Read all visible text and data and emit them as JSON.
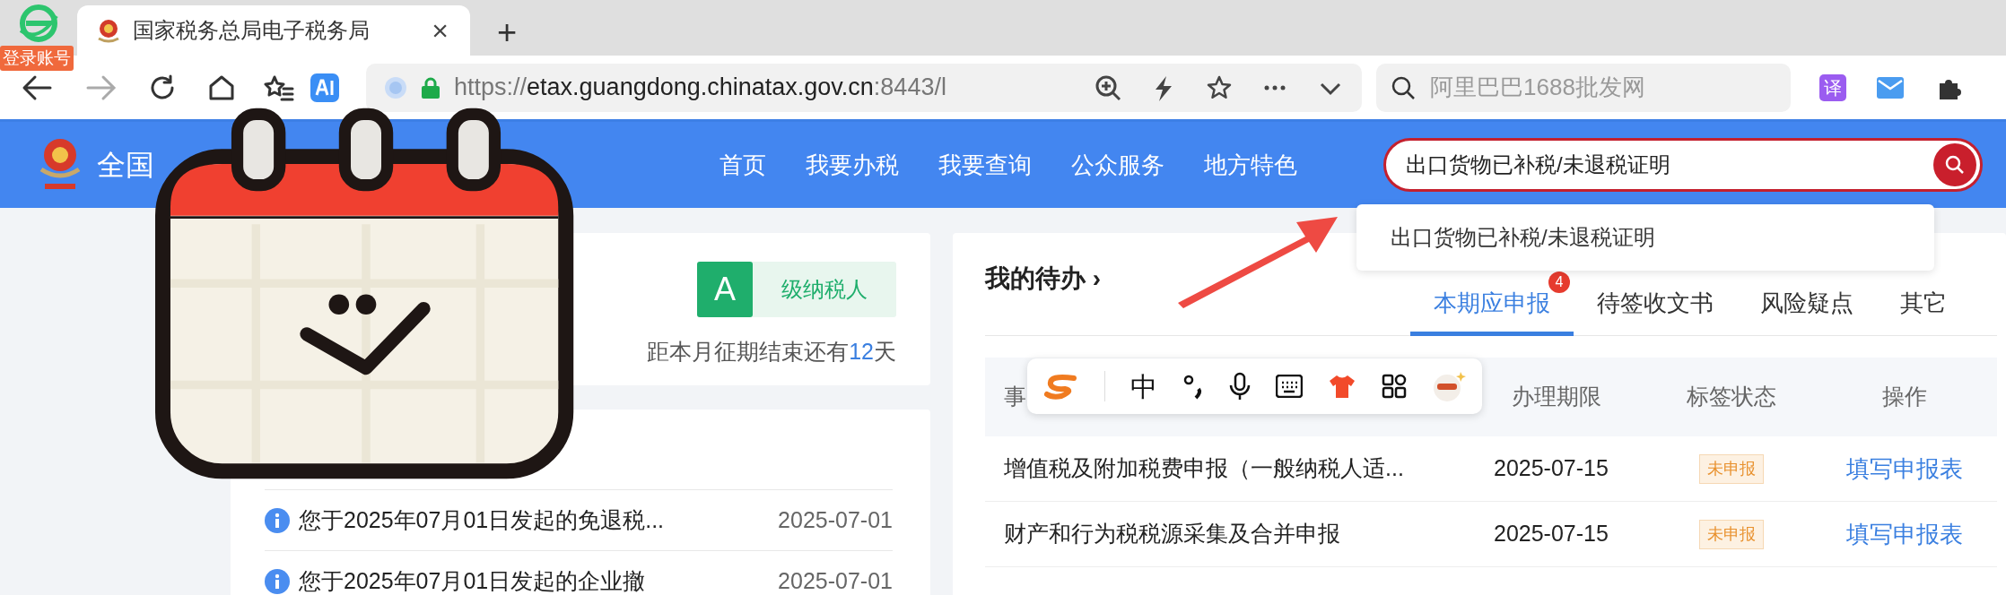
{
  "browser": {
    "login_badge": "登录账号",
    "tabs": [
      {
        "title": "国家税务总局电子税务局",
        "selected": true,
        "close": "×"
      }
    ],
    "new_tab": "+",
    "url_scheme": "https://",
    "url_host": "etax.guangdong.chinatax.gov.cn",
    "url_rest": ":8443/l",
    "search_placeholder": "阿里巴巴1688批发网",
    "translate_label": "译"
  },
  "site": {
    "title": "全国",
    "nav": [
      "首页",
      "我要办税",
      "我要查询",
      "公众服务",
      "地方特色"
    ],
    "search_value": "出口货物已补税/未退税证明",
    "suggestions": [
      "出口货物已补税/未退税证明"
    ]
  },
  "taxpayer": {
    "grade": "A",
    "grade_label": "级纳税人",
    "deadline_prefix": "距本月征期结束还有",
    "deadline_days": "12",
    "deadline_suffix": "天"
  },
  "notices": [
    {
      "text": "您于2025年07月01日发起的免退税...",
      "date": "2025-07-01"
    },
    {
      "text": "您于2025年07月01日发起的企业撤",
      "date": "2025-07-01"
    }
  ],
  "todo": {
    "title": "我的待办",
    "chevron": "›",
    "tabs": [
      {
        "label": "本期应申报",
        "selected": true,
        "badge": "4"
      },
      {
        "label": "待签收文书",
        "selected": false
      },
      {
        "label": "风险疑点",
        "selected": false
      },
      {
        "label": "其它",
        "selected": false
      }
    ],
    "columns": [
      "事",
      "办理期限",
      "标签状态",
      "操作"
    ],
    "rows": [
      {
        "name": "增值税及附加税费申报（一般纳税人适...",
        "deadline": "2025-07-15",
        "status": "未申报",
        "action": "填写申报表"
      },
      {
        "name": "财产和行为税税源采集及合并申报",
        "deadline": "2025-07-15",
        "status": "未申报",
        "action": "填写申报表"
      }
    ]
  },
  "ime": {
    "mode": "中"
  }
}
